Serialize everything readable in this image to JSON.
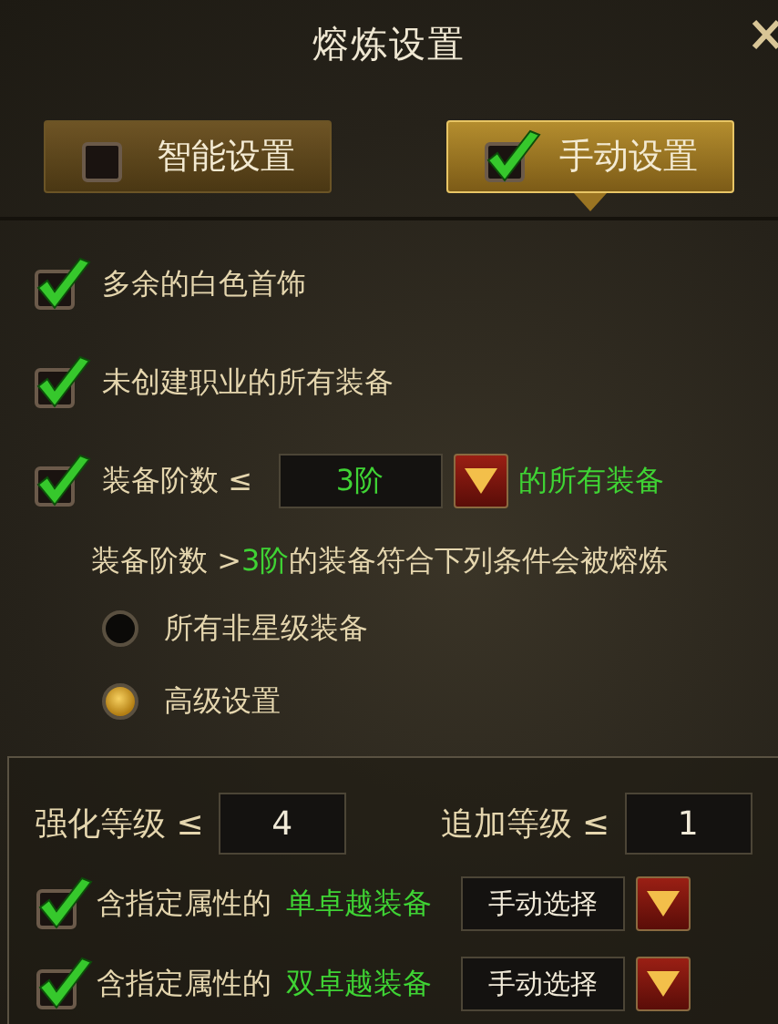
{
  "title": "熔炼设置",
  "tabs": [
    {
      "label": "智能设置",
      "selected": false
    },
    {
      "label": "手动设置",
      "selected": true
    }
  ],
  "options": [
    {
      "kind": "check",
      "checked": true,
      "label": "多余的白色首饰"
    },
    {
      "kind": "check",
      "checked": true,
      "label": "未创建职业的所有装备"
    },
    {
      "kind": "tier",
      "checked": true,
      "label": "装备阶数 ≤",
      "value": "3阶",
      "suffix": "的所有装备"
    }
  ],
  "note": {
    "before": "装备阶数 >",
    "highlight": "3阶",
    "after": "的装备符合下列条件会被熔炼"
  },
  "radios": [
    {
      "label": "所有非星级装备",
      "selected": false
    },
    {
      "label": "高级设置",
      "selected": true
    }
  ],
  "levels": [
    {
      "label": "强化等级 ≤",
      "value": "4"
    },
    {
      "label": "追加等级 ≤",
      "value": "1"
    }
  ],
  "attributes": [
    {
      "checked": true,
      "label": "含指定属性的",
      "highlight": "单卓越装备",
      "value": "手动选择"
    },
    {
      "checked": true,
      "label": "含指定属性的",
      "highlight": "双卓越装备",
      "value": "手动选择"
    }
  ]
}
